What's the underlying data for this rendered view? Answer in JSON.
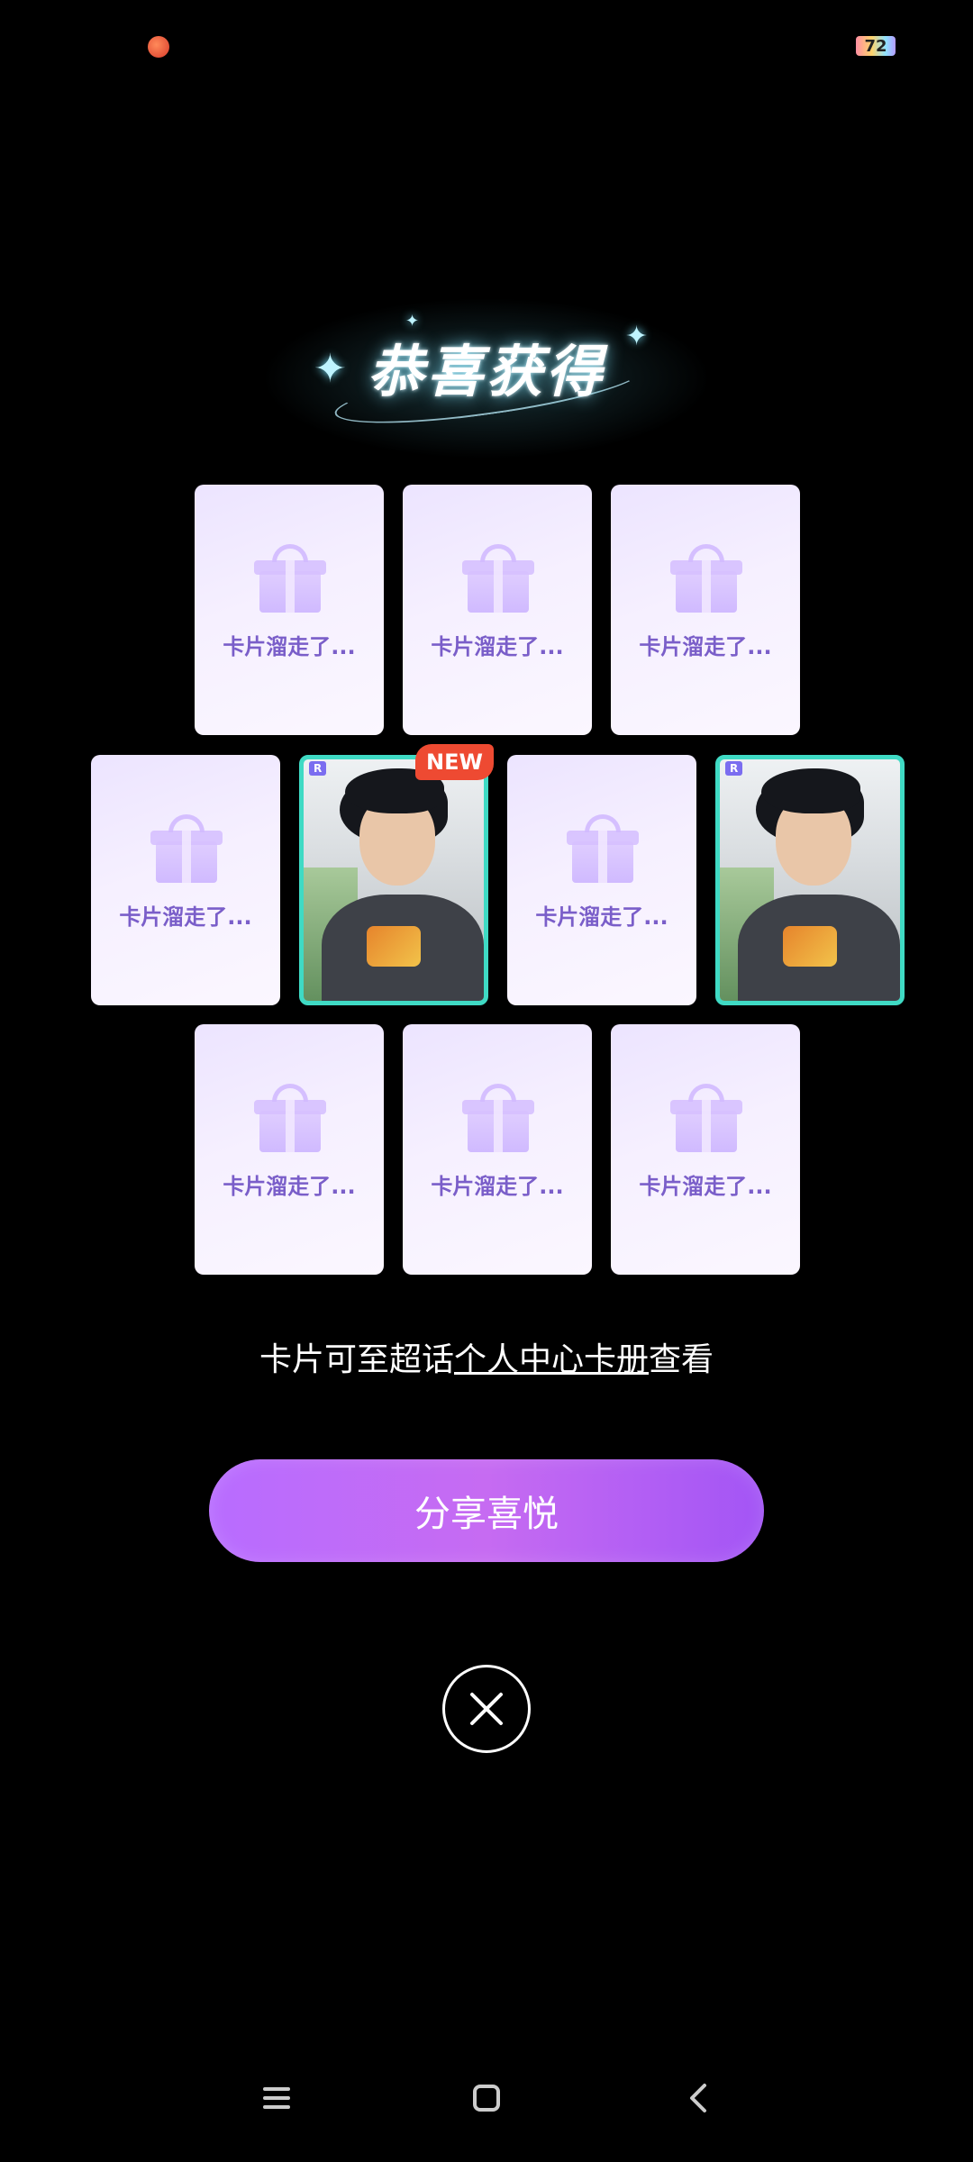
{
  "status_bar": {
    "battery": "72"
  },
  "title": "恭喜获得",
  "cards": {
    "missing_label": "卡片溜走了...",
    "rarity_badge": "R",
    "new_badge": "NEW"
  },
  "info": {
    "prefix": "卡片可至超话",
    "link": "个人中心卡册",
    "suffix": "查看"
  },
  "share_button": "分享喜悦",
  "icons": {
    "close": "close-icon",
    "menu": "menu-icon",
    "home": "home-icon",
    "back": "back-icon"
  }
}
